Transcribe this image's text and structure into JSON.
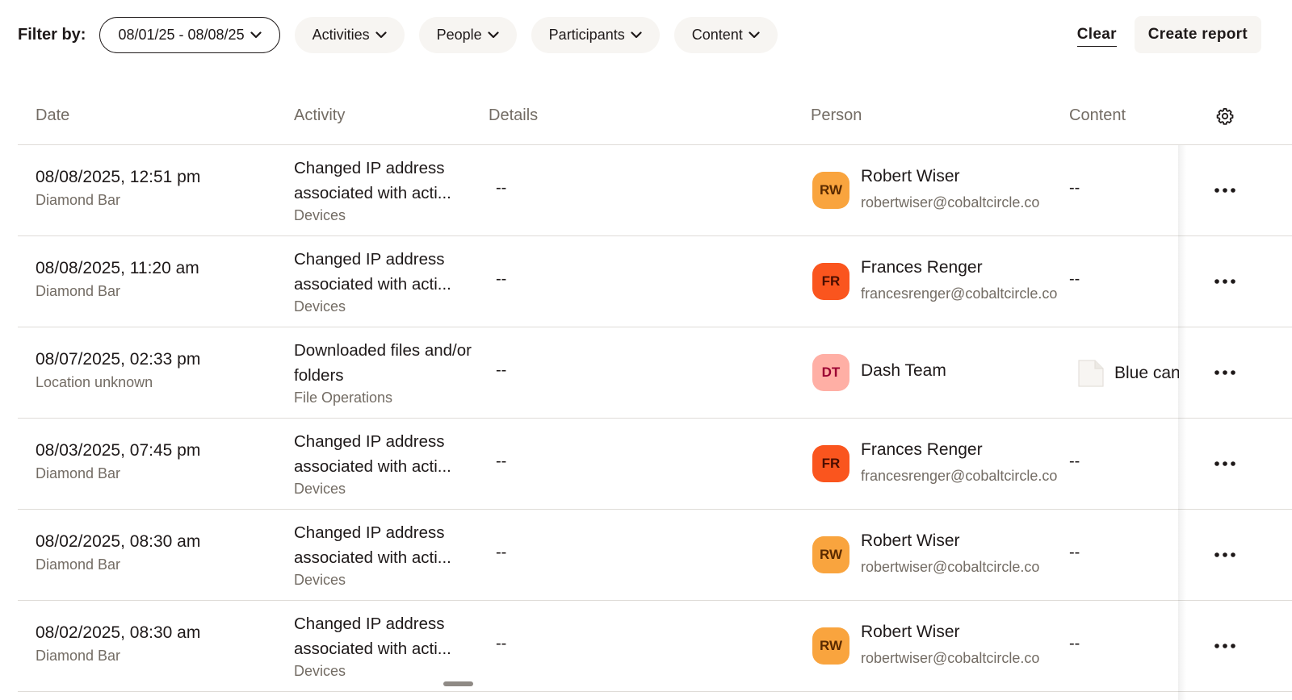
{
  "filters": {
    "label": "Filter by:",
    "chips": [
      {
        "label": "08/01/25 - 08/08/25",
        "selected": true
      },
      {
        "label": "Activities",
        "selected": false
      },
      {
        "label": "People",
        "selected": false
      },
      {
        "label": "Participants",
        "selected": false
      },
      {
        "label": "Content",
        "selected": false
      }
    ],
    "clear_label": "Clear",
    "create_report_label": "Create report"
  },
  "table": {
    "columns": [
      "Date",
      "Activity",
      "Details",
      "Person",
      "Content"
    ],
    "settings_icon": "gear-icon",
    "rows": [
      {
        "date": "08/08/2025, 12:51 pm",
        "location": "Diamond Bar",
        "activity": "Changed IP address associated with acti...",
        "category": "Devices",
        "details": "--",
        "initials": "RW",
        "avatar_color": "#f9a43e",
        "initials_color": "#5a2a00",
        "name": "Robert Wiser",
        "email": "robertwiser@cobaltcircle.co",
        "content": "--"
      },
      {
        "date": "08/08/2025, 11:20 am",
        "location": "Diamond Bar",
        "activity": "Changed IP address associated with acti...",
        "category": "Devices",
        "details": "--",
        "initials": "FR",
        "avatar_color": "#fa551e",
        "initials_color": "#4a0e00",
        "name": "Frances Renger",
        "email": "francesrenger@cobaltcircle.co",
        "content": "--"
      },
      {
        "date": "08/07/2025, 02:33 pm",
        "location": "Location unknown",
        "activity": "Downloaded files and/or folders",
        "category": "File Operations",
        "details": "--",
        "initials": "DT",
        "avatar_color": "#ffafa5",
        "initials_color": "#9b0032",
        "name": "Dash Team",
        "email": "",
        "content": "Blue can",
        "content_icon": "file-icon"
      },
      {
        "date": "08/03/2025, 07:45 pm",
        "location": "Diamond Bar",
        "activity": "Changed IP address associated with acti...",
        "category": "Devices",
        "details": "--",
        "initials": "FR",
        "avatar_color": "#fa551e",
        "initials_color": "#4a0e00",
        "name": "Frances Renger",
        "email": "francesrenger@cobaltcircle.co",
        "content": "--"
      },
      {
        "date": "08/02/2025, 08:30 am",
        "location": "Diamond Bar",
        "activity": "Changed IP address associated with acti...",
        "category": "Devices",
        "details": "--",
        "initials": "RW",
        "avatar_color": "#f9a43e",
        "initials_color": "#5a2a00",
        "name": "Robert Wiser",
        "email": "robertwiser@cobaltcircle.co",
        "content": "--"
      },
      {
        "date": "08/02/2025, 08:30 am",
        "location": "Diamond Bar",
        "activity": "Changed IP address associated with acti...",
        "category": "Devices",
        "details": "--",
        "initials": "RW",
        "avatar_color": "#f9a43e",
        "initials_color": "#5a2a00",
        "name": "Robert Wiser",
        "email": "robertwiser@cobaltcircle.co",
        "content": "--"
      }
    ]
  }
}
